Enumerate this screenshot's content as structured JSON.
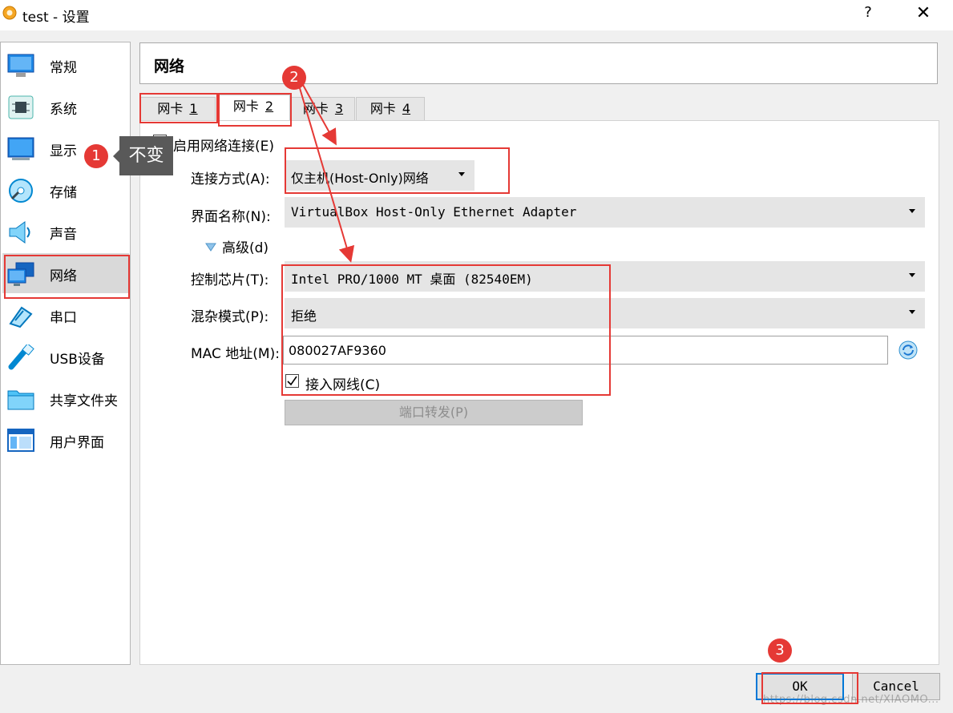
{
  "window": {
    "title": "test - 设置",
    "help_glyph": "?",
    "close_glyph": "✕"
  },
  "sidebar": {
    "items": [
      {
        "label": "常规",
        "icon": "monitor-icon"
      },
      {
        "label": "系统",
        "icon": "chip-icon"
      },
      {
        "label": "显示",
        "icon": "display-icon"
      },
      {
        "label": "存储",
        "icon": "disk-icon"
      },
      {
        "label": "声音",
        "icon": "speaker-icon"
      },
      {
        "label": "网络",
        "icon": "network-icon",
        "selected": true
      },
      {
        "label": "串口",
        "icon": "serial-port-icon"
      },
      {
        "label": "USB设备",
        "icon": "usb-icon"
      },
      {
        "label": "共享文件夹",
        "icon": "folder-icon"
      },
      {
        "label": "用户界面",
        "icon": "ui-window-icon"
      }
    ]
  },
  "header": {
    "title": "网络"
  },
  "tabs": [
    {
      "label": "网卡",
      "num": "1",
      "active": false
    },
    {
      "label": "网卡",
      "num": "2",
      "active": true
    },
    {
      "label": "网卡",
      "num": "3",
      "active": false
    },
    {
      "label": "网卡",
      "num": "4",
      "active": false
    }
  ],
  "form": {
    "enable": {
      "label": "启用网络连接(E)",
      "checked": true
    },
    "attach": {
      "label": "连接方式(A):",
      "value": "仅主机(Host-Only)网络"
    },
    "name": {
      "label": "界面名称(N):",
      "value": "VirtualBox Host-Only Ethernet Adapter"
    },
    "advanced": {
      "label": "高级(d)"
    },
    "adapter_type": {
      "label": "控制芯片(T):",
      "value": "Intel PRO/1000 MT 桌面 (82540EM)"
    },
    "promisc": {
      "label": "混杂模式(P):",
      "value": "拒绝"
    },
    "mac": {
      "label": "MAC 地址(M):",
      "value": "080027AF9360"
    },
    "cable": {
      "label": "接入网线(C)",
      "checked": true
    },
    "port_forwarding": {
      "label": "端口转发(P)"
    }
  },
  "buttons": {
    "ok": "OK",
    "cancel": "Cancel"
  },
  "annotations": {
    "badge1": "1",
    "badge2": "2",
    "badge3": "3",
    "tooltip": "不变",
    "color": "#e53935"
  },
  "watermark": "https://blog.csdn.net/XIAOMO..."
}
